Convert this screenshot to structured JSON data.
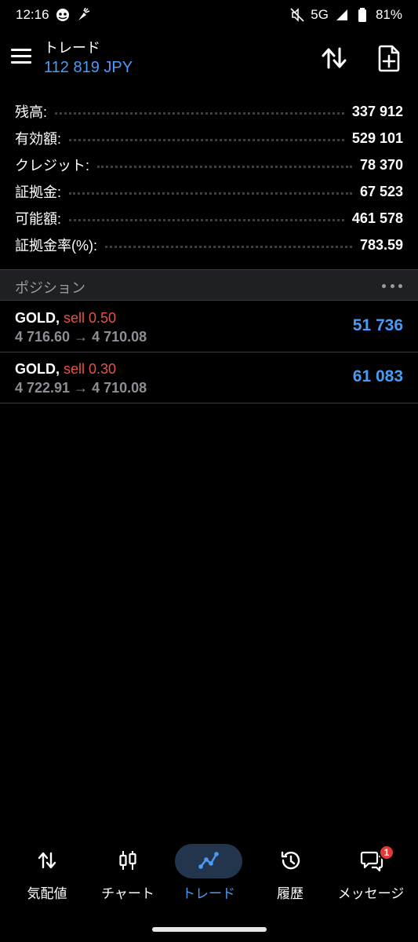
{
  "status_bar": {
    "time": "12:16",
    "network": "5G",
    "battery": "81%",
    "icons": [
      "app-notification-icon",
      "carrot-icon",
      "mute-icon",
      "signal-icon",
      "battery-icon"
    ]
  },
  "header": {
    "title": "トレード",
    "subtitle": "112 819 JPY",
    "icons": [
      "menu-icon",
      "sort-icon",
      "new-order-icon"
    ]
  },
  "account": {
    "rows": [
      {
        "label": "残高:",
        "value": "337 912"
      },
      {
        "label": "有効額:",
        "value": "529 101"
      },
      {
        "label": "クレジット:",
        "value": "78 370"
      },
      {
        "label": "証拠金:",
        "value": "67 523"
      },
      {
        "label": "可能額:",
        "value": "461 578"
      },
      {
        "label": "証拠金率(%):",
        "value": "783.59"
      }
    ]
  },
  "positions_section": {
    "title": "ポジション",
    "more_icon": "more-horizontal-icon"
  },
  "positions": [
    {
      "symbol": "GOLD,",
      "side": "sell 0.50",
      "prices": "4 716.60 → 4 710.08",
      "profit": "51 736"
    },
    {
      "symbol": "GOLD,",
      "side": "sell 0.30",
      "prices": "4 722.91 → 4 710.08",
      "profit": "61 083"
    }
  ],
  "bottom_nav": {
    "items": [
      {
        "label": "気配値",
        "icon": "quotes-icon",
        "active": false
      },
      {
        "label": "チャート",
        "icon": "chart-icon",
        "active": false
      },
      {
        "label": "トレード",
        "icon": "trade-icon",
        "active": true
      },
      {
        "label": "履歴",
        "icon": "history-icon",
        "active": false
      },
      {
        "label": "メッセージ",
        "icon": "messages-icon",
        "active": false,
        "badge": "1"
      }
    ]
  },
  "colors": {
    "accent_blue": "#4a9bf5",
    "sell_red": "#e5534b",
    "badge_red": "#e53935",
    "background": "#000000"
  }
}
